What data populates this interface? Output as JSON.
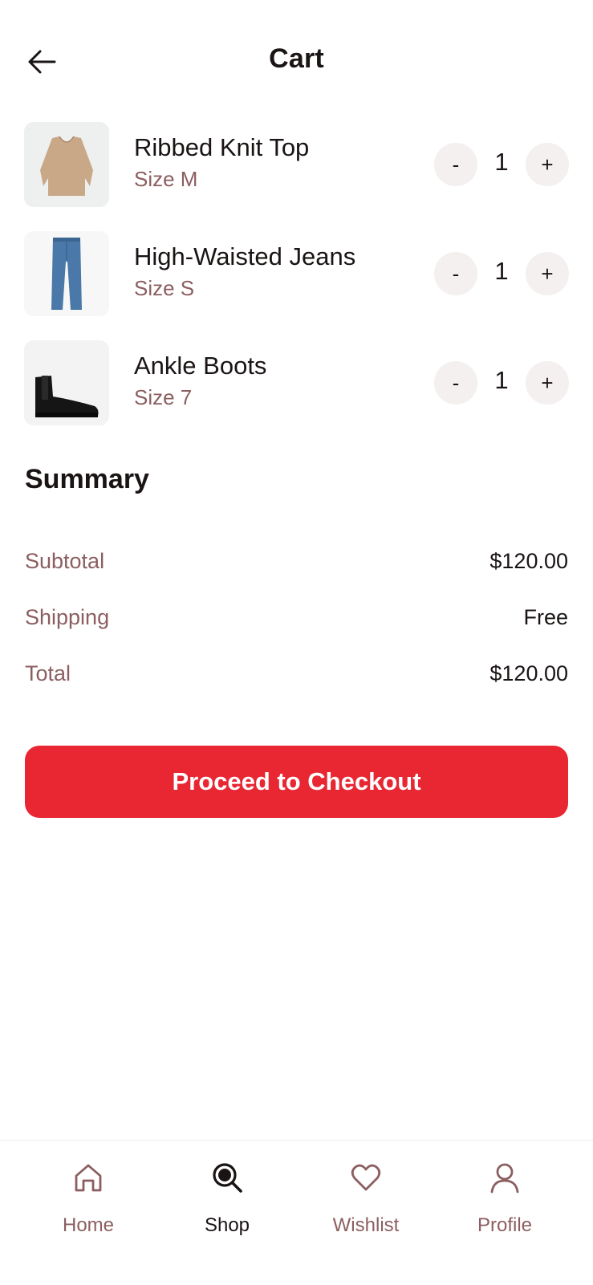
{
  "header": {
    "title": "Cart",
    "back_icon": "arrow-left-icon"
  },
  "items": [
    {
      "name": "Ribbed Knit Top",
      "size": "Size M",
      "quantity": "1",
      "minus": "-",
      "plus": "+"
    },
    {
      "name": "High-Waisted Jeans",
      "size": "Size S",
      "quantity": "1",
      "minus": "-",
      "plus": "+"
    },
    {
      "name": "Ankle Boots",
      "size": "Size 7",
      "quantity": "1",
      "minus": "-",
      "plus": "+"
    }
  ],
  "summary": {
    "title": "Summary",
    "subtotal_label": "Subtotal",
    "subtotal_value": "$120.00",
    "shipping_label": "Shipping",
    "shipping_value": "Free",
    "total_label": "Total",
    "total_value": "$120.00"
  },
  "checkout": {
    "label": "Proceed to Checkout"
  },
  "nav": [
    {
      "label": "Home",
      "icon": "home-icon",
      "active": false
    },
    {
      "label": "Shop",
      "icon": "search-icon",
      "active": true
    },
    {
      "label": "Wishlist",
      "icon": "heart-icon",
      "active": false
    },
    {
      "label": "Profile",
      "icon": "user-icon",
      "active": false
    }
  ],
  "colors": {
    "accent": "#e82733",
    "muted": "#8c5e60",
    "text": "#1a1414",
    "chip": "#f3f0ef"
  }
}
